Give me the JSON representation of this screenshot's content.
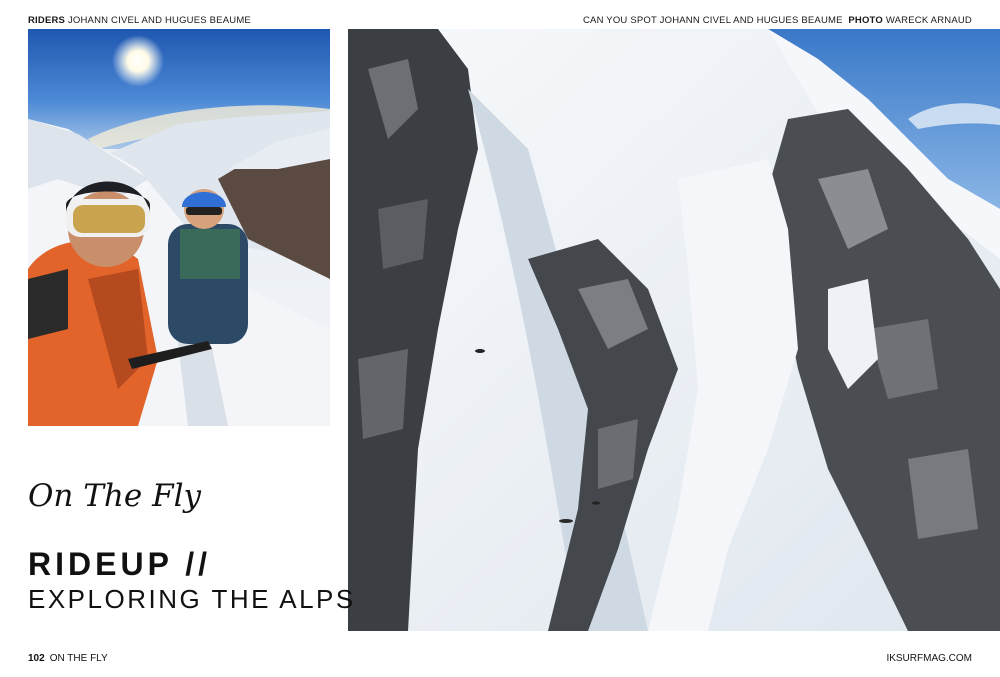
{
  "header": {
    "left_label": "RIDERS",
    "left_text": "JOHANN CIVEL AND HUGUES BEAUME",
    "right_text": "CAN YOU SPOT JOHANN CIVEL AND HUGUES BEAUME",
    "right_label": "PHOTO",
    "right_credit": "WARECK ARNAUD"
  },
  "article": {
    "kicker": "On The Fly",
    "title": "RIDEUP //",
    "subtitle": "EXPLORING THE ALPS"
  },
  "footer": {
    "page_number": "102",
    "section": "ON THE FLY",
    "website": "IKSURFMAG.COM"
  },
  "images": {
    "left_photo": "selfie-of-two-riders-on-snowy-ridge",
    "right_photo": "aerial-view-of-snowy-alpine-couloir"
  },
  "colors": {
    "jacket": "#e2642a",
    "sky": "#3e7ccc",
    "rock": "#3b3e42",
    "snow": "#f3f5f8"
  }
}
